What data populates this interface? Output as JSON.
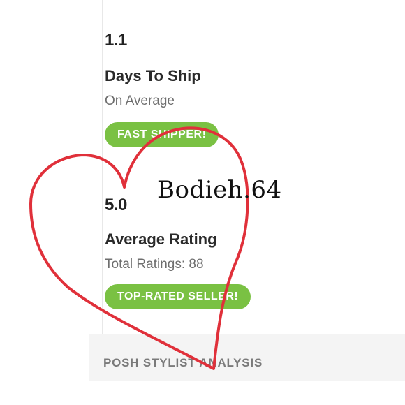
{
  "stats": [
    {
      "value": "1.1",
      "title": "Days To Ship",
      "subtitle": "On Average",
      "badge": "FAST SHIPPER!"
    },
    {
      "value": "5.0",
      "title": "Average Rating",
      "subtitle": "Total Ratings: 88",
      "badge": "TOP-RATED SELLER!"
    }
  ],
  "section": {
    "heading": "POSH STYLIST ANALYSIS"
  },
  "overlay": {
    "username": "Bodieh.64",
    "heart_color": "#e0303a"
  },
  "colors": {
    "badge_green": "#7ac143",
    "heading_gray": "#7a7a7a"
  }
}
